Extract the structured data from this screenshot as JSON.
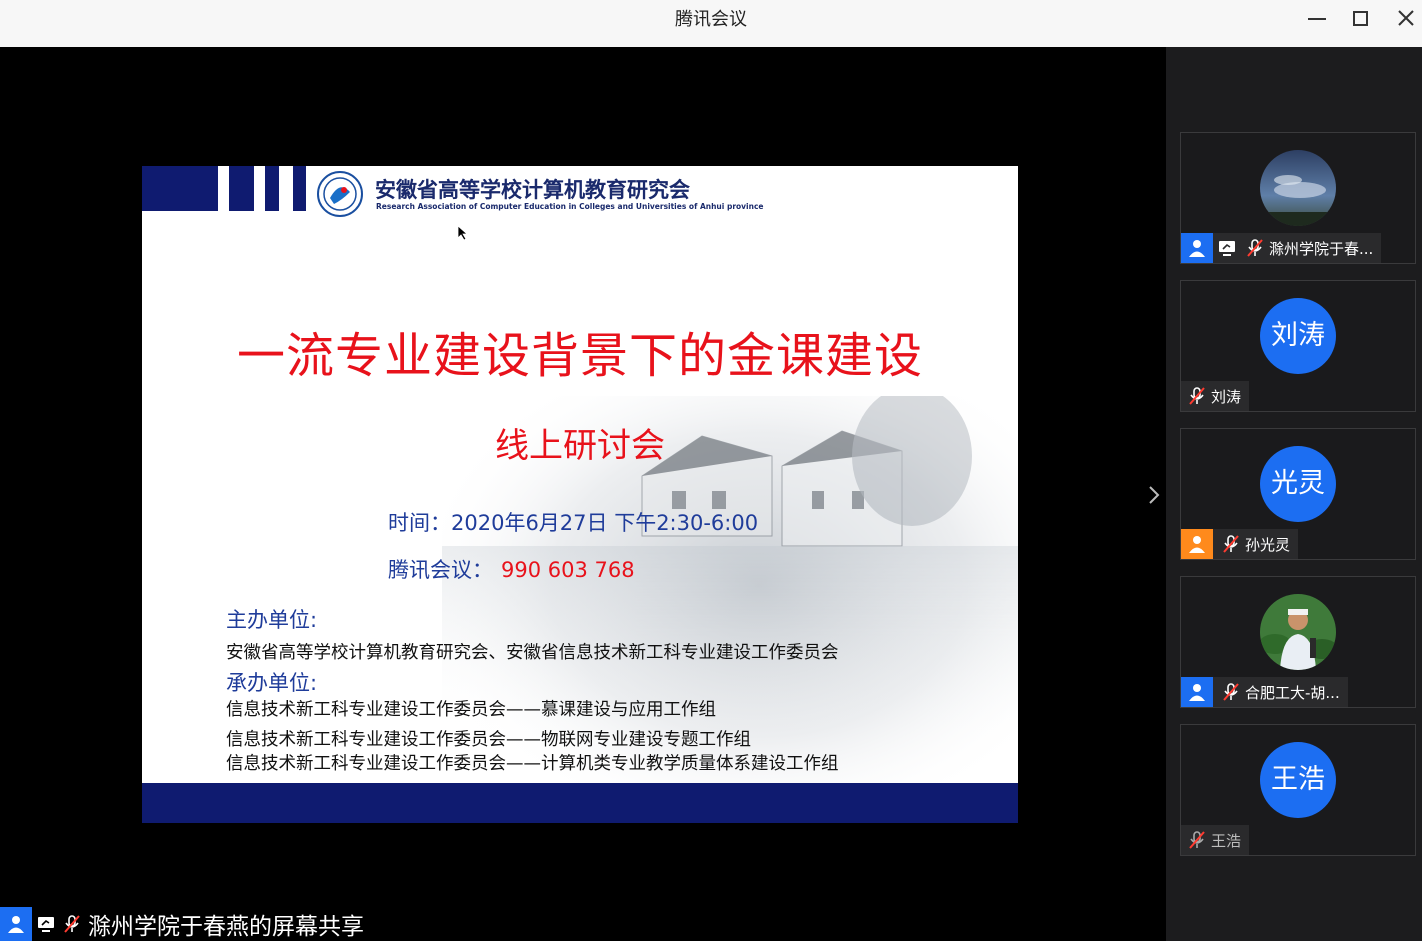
{
  "window": {
    "title": "腾讯会议"
  },
  "slide": {
    "org_name": "安徽省高等学校计算机教育研究会",
    "org_name_en": "Research Association of Computer Education in Colleges and Universities of Anhui province",
    "main_title": "一流专业建设背景下的金课建设",
    "subtitle": "线上研讨会",
    "time_label": "时间：2020年6月27日 下午2:30-6:00",
    "meeting_label": "腾讯会议：",
    "meeting_number": "990 603 768",
    "host_label": "主办单位:",
    "host_text": "安徽省高等学校计算机教育研究会、安徽省信息技术新工科专业建设工作委员会",
    "co_label": "承办单位:",
    "co_lines": [
      "信息技术新工科专业建设工作委员会——慕课建设与应用工作组",
      "信息技术新工科专业建设工作委员会——物联网专业建设专题工作组",
      "信息技术新工科专业建设工作委员会——计算机类专业教学质量体系建设工作组"
    ]
  },
  "participants": [
    {
      "name": "滁州学院于春...",
      "avatar": "photo-sky",
      "role": "host",
      "sharing": true,
      "muted": true
    },
    {
      "name": "刘涛",
      "avatar_text": "刘涛",
      "role": "none",
      "sharing": false,
      "muted": true
    },
    {
      "name": "孙光灵",
      "avatar_text": "光灵",
      "role": "cohost",
      "sharing": false,
      "muted": true
    },
    {
      "name": "合肥工大-胡...",
      "avatar": "photo-person",
      "role": "host",
      "sharing": false,
      "muted": true
    },
    {
      "name": "王浩",
      "avatar_text": "王浩",
      "role": "none",
      "sharing": false,
      "muted": true
    }
  ],
  "share_bar": {
    "text": "滁州学院于春燕的屏幕共享"
  },
  "colors": {
    "accent_blue": "#1c6ef2",
    "cohost_orange": "#ff8a1c",
    "slide_red": "#e8121b",
    "slide_navy": "#0f1b70"
  }
}
